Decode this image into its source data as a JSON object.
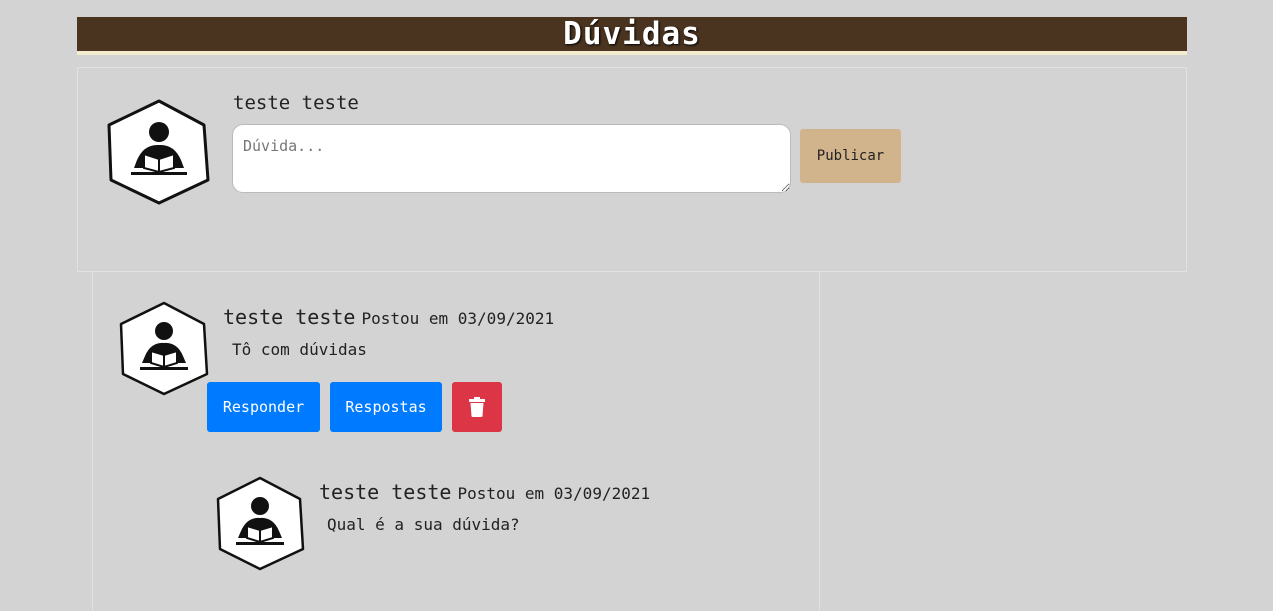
{
  "header": {
    "title": "Dúvidas"
  },
  "compose": {
    "user_name": "teste teste",
    "placeholder": "Dúvida...",
    "value": "",
    "publish_label": "Publicar",
    "avatar_icon": "reading-person-hexagon-icon"
  },
  "post": {
    "user_name": "teste teste",
    "date_label": "Postou em 03/09/2021",
    "text": "Tô com dúvidas",
    "reply_label": "Responder",
    "answers_label": "Respostas",
    "delete_icon": "trash-icon",
    "avatar_icon": "reading-person-hexagon-icon"
  },
  "reply": {
    "user_name": "teste teste",
    "date_label": "Postou em 03/09/2021",
    "text": "Qual é a sua dúvida?",
    "avatar_icon": "reading-person-hexagon-icon"
  },
  "colors": {
    "header_bg": "#4a3420",
    "header_underline": "#f3ecd0",
    "page_bg": "#d3d3d3",
    "publish_bg": "#d2b48c",
    "primary_button": "#007bff",
    "danger_button": "#dc3545"
  }
}
